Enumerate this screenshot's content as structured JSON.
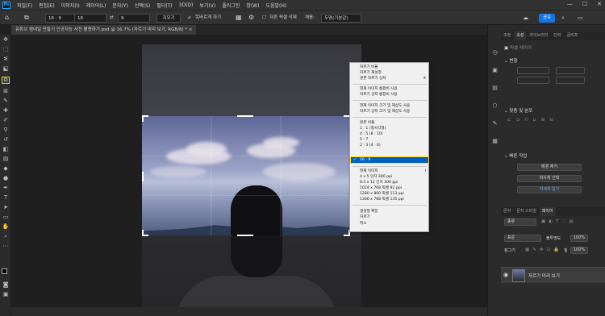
{
  "app": {
    "logo": "Ps"
  },
  "menu": [
    "파일(F)",
    "편집(E)",
    "이미지(I)",
    "레이어(L)",
    "문자(Y)",
    "선택(S)",
    "필터(T)",
    "3D(D)",
    "보기(V)",
    "플러그인",
    "창(W)",
    "도움말(H)"
  ],
  "window": {
    "min": "—",
    "max": "☐",
    "close": "✕"
  },
  "options": {
    "ratio": "16 : 9",
    "ratio_w": "16",
    "ratio_h": "9",
    "swap": "⇄",
    "clear": "지우기",
    "straighten": "똑바르게 하기",
    "delete_pixels": "자른 픽셀 삭제",
    "fill": "두명(기본값)",
    "share": "공유"
  },
  "doc_tab": "유튜브 썸네일 만들기 인공지능 사진 활용하기.psd @ 16.7% (자르기 미리 보기, RGB/8) *",
  "context_menu": {
    "items_group1": [
      "자르기 비율",
      "자르기 재설정",
      "원본 자르기 상자"
    ],
    "shortcut_x": "X",
    "items_group2": [
      "현재 이미지 통합비 사용",
      "자르기 상자 통합비 사용"
    ],
    "items_group3": [
      "현재 이미지 크기 및 해상도 사용",
      "자르기 상자 크기 및 해상도 사용"
    ],
    "items_group4": [
      "원본 비율",
      "1 : 1 (정사각형)",
      "4 : 5 (8 : 10)",
      "5 : 7",
      "2 : 3 (4 : 6)"
    ],
    "selected": "16 : 9",
    "check": "✓",
    "items_group5": [
      "현재 이미지",
      "4 x 5 인치 300 ppi",
      "8.5 x 11 인치 300 ppi",
      "1024 x 768 픽셀 92 ppi",
      "1280 x 800 픽셀 113 ppi",
      "1366 x 768 픽셀 135 ppi"
    ],
    "shortcut_i": "I",
    "items_group6": [
      "생성형 확장",
      "자르기",
      "취소"
    ]
  },
  "panels": {
    "top_tabs": [
      "조정",
      "속성",
      "라이브러리",
      "단락",
      "글리프"
    ],
    "props_label": "픽셀 레이어",
    "transform": "변형",
    "align": "맞춤 및 분포",
    "quick_actions": "빠른 작업",
    "btn_remove_bg": "배경 제거",
    "btn_select_subject": "피사체 선택",
    "btn_more": "자세히 알기",
    "layer_tabs": [
      "문자",
      "문자 스타일",
      "레이어"
    ],
    "layer_kind": "종류",
    "blend": "표준",
    "opacity_label": "불투명도",
    "opacity": "100%",
    "lock_label": "잠그기",
    "fill_label": "칠",
    "fill": "100%",
    "layer_name": "자르기 미리 보기"
  }
}
